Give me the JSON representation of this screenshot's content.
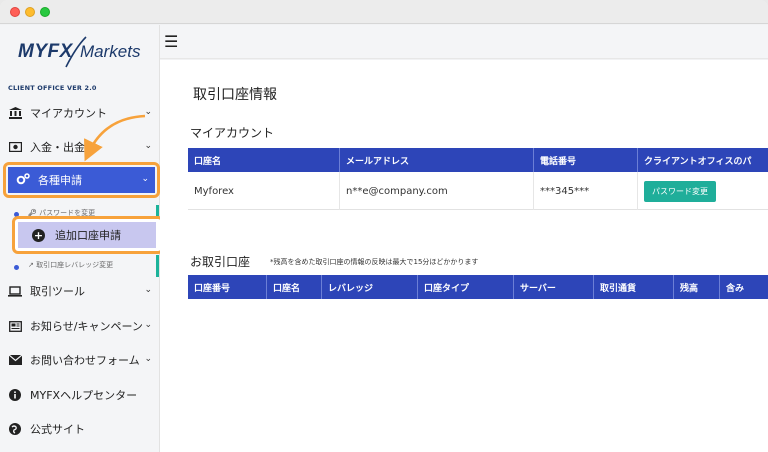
{
  "brand": {
    "logo_main": "MYFX",
    "logo_sub": "Markets",
    "version": "CLIENT OFFICE VER 2.0"
  },
  "colors": {
    "accent": "#2d45b8",
    "active_nav": "#3b5bd6",
    "highlight_border": "#f7a23b",
    "button_green": "#1fae9a",
    "highlight_bg": "#c8c7ef"
  },
  "sidebar": {
    "items": [
      {
        "label": "マイアカウント",
        "icon": "bank-icon",
        "chevron": "⌄"
      },
      {
        "label": "入金・出金",
        "icon": "money-icon",
        "chevron": "⌄"
      },
      {
        "label": "各種申請",
        "icon": "gears-icon",
        "chevron": "⌄"
      },
      {
        "label": "パスワードを変更",
        "icon": "key-icon"
      },
      {
        "label": "追加口座申請",
        "icon": "plus-circle-icon"
      },
      {
        "label": "取引口座レバレッジ変更",
        "icon": "arrows-icon"
      },
      {
        "label": "取引ツール",
        "icon": "laptop-icon",
        "chevron": "⌄"
      },
      {
        "label": "お知らせ/キャンペーン",
        "icon": "newspaper-icon",
        "chevron": "⌄"
      },
      {
        "label": "お問い合わせフォーム",
        "icon": "envelope-icon",
        "chevron": "⌄"
      },
      {
        "label": "MYFXヘルプセンター",
        "icon": "info-icon"
      },
      {
        "label": "公式サイト",
        "icon": "globe-icon"
      }
    ]
  },
  "main": {
    "page_title": "取引口座情報",
    "my_account": {
      "title": "マイアカウント",
      "headers": [
        "口座名",
        "メールアドレス",
        "電話番号",
        "クライアントオフィスのパ"
      ],
      "row": {
        "name": "Myforex",
        "email": "n**e@company.com",
        "phone": "***345***",
        "button": "パスワード変更"
      }
    },
    "trading_accounts": {
      "title": "お取引口座",
      "note": "*残高を含めた取引口座の情報の反映は最大で15分ほどかかります",
      "headers": [
        "口座番号",
        "口座名",
        "レバレッジ",
        "口座タイプ",
        "サーバー",
        "取引通貨",
        "残高",
        "含み"
      ]
    }
  }
}
